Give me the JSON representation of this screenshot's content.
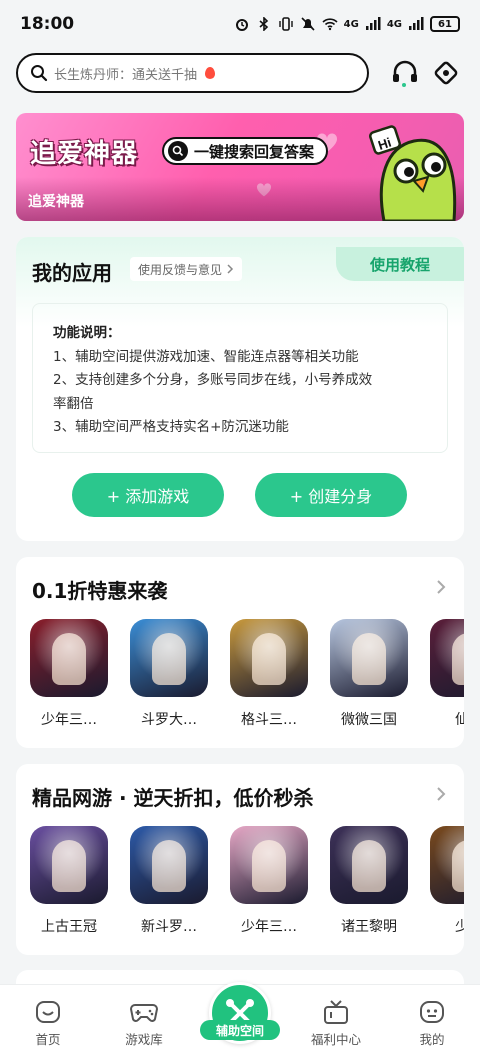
{
  "status_bar": {
    "time": "18:00",
    "battery": "61",
    "network": "4G"
  },
  "search": {
    "placeholder": "长生炼丹师：通关送千抽"
  },
  "header_icons": [
    "headset-icon",
    "settings-diamond-icon"
  ],
  "banner": {
    "title": "追爱神器",
    "pill": "一键搜索回复答案",
    "subtitle": "追爱神器"
  },
  "my_apps": {
    "title": "我的应用",
    "feedback_label": "使用反馈与意见",
    "tutorial_label": "使用教程",
    "desc_heading": "功能说明：",
    "desc_lines": [
      "1、辅助空间提供游戏加速、智能连点器等相关功能",
      "2、支持创建多个分身，多账号同步在线，小号养成效",
      "率翻倍",
      "3、辅助空间严格支持实名+防沉迷功能"
    ],
    "add_game_label": "+ 添加游戏",
    "create_clone_label": "+ 创建分身"
  },
  "section_discount": {
    "title": "0.1折特惠来袭",
    "games": [
      {
        "name": "少年三…",
        "color": "#8a1f2c"
      },
      {
        "name": "斗罗大…",
        "color": "#3b8ed6"
      },
      {
        "name": "格斗三…",
        "color": "#c99a3e"
      },
      {
        "name": "微微三国",
        "color": "#b8c7e0"
      },
      {
        "name": "仙灵",
        "color": "#5b1f3a"
      }
    ]
  },
  "section_premium": {
    "title": "精品网游 · 逆天折扣，低价秒杀",
    "games": [
      {
        "name": "上古王冠",
        "color": "#6a4fa0"
      },
      {
        "name": "新斗罗…",
        "color": "#2d5aa8"
      },
      {
        "name": "少年三…",
        "color": "#e7a9c7"
      },
      {
        "name": "诸王黎明",
        "color": "#3d3158"
      },
      {
        "name": "少年",
        "color": "#7a4a1e"
      }
    ]
  },
  "tabbar": {
    "items": [
      {
        "label": "首页",
        "icon": "home-icon"
      },
      {
        "label": "游戏库",
        "icon": "gamepad-icon"
      },
      {
        "label": "辅助空间",
        "icon": "tools-icon"
      },
      {
        "label": "福利中心",
        "icon": "gift-tv-icon"
      },
      {
        "label": "我的",
        "icon": "profile-face-icon"
      }
    ]
  },
  "colors": {
    "accent": "#2bc78d",
    "accent_dark": "#17a46c",
    "banner_pink": "#ff5fae"
  }
}
